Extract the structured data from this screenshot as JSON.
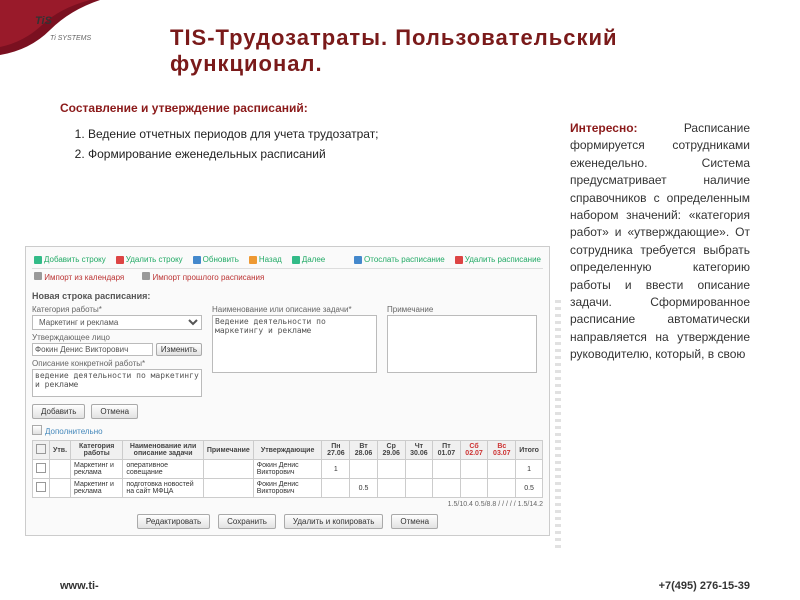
{
  "logo": {
    "main": "TiS",
    "sub": "Ti SYSTEMS"
  },
  "title": "TIS-Трудозатраты. Пользовательский функционал.",
  "left": {
    "heading": "Составление и утверждение расписаний:",
    "items": [
      "Ведение отчетных периодов для учета трудозатрат;",
      "Формирование еженедельных расписаний"
    ]
  },
  "side": {
    "label": "Интересно:",
    "body": "Расписание формируется сотрудниками еженедельно. Система предусматривает наличие справочников с определенным набором значений: «категория работ» и «утверждающие». От сотрудника требуется выбрать определенную категорию работы и ввести описание задачи. Сформированное расписание автоматически направляется на утверждение руководителю, который, в свою"
  },
  "toolbar": {
    "add": "Добавить строку",
    "del": "Удалить строку",
    "upd": "Обновить",
    "back": "Назад",
    "next": "Далее",
    "send": "Отослать расписание",
    "remove": "Удалить расписание",
    "importCal": "Импорт из календаря",
    "importPrev": "Импорт прошлого расписания"
  },
  "form": {
    "section": "Новая строка расписания:",
    "catLabel": "Категория работы*",
    "catValue": "Маркетинг и реклама",
    "apprLabel": "Утверждающее лицо",
    "apprValue": "Фокин Денис Викторович",
    "apprBtn": "Изменить",
    "descLabel": "Наименование или описание задачи*",
    "descValue": "Ведение деятельности по маркетингу и рекламе",
    "objLabel": "Описание конкретной работы*",
    "objValue": "ведение деятельности по маркетингу и рекламе",
    "noteLabel": "Примечание",
    "noteValue": "",
    "addBtn": "Добавить",
    "cancelBtn": "Отмена",
    "additional": "Дополнительно"
  },
  "table": {
    "headers": {
      "approve": "Утв.",
      "cat": "Категория работы",
      "desc": "Наименование или описание задачи",
      "note": "Примечание",
      "appr": "Утверждающие",
      "d1": "Пн 27.06",
      "d2": "Вт 28.06",
      "d3": "Ср 29.06",
      "d4": "Чт 30.06",
      "d5": "Пт 01.07",
      "d6": "Сб 02.07",
      "d7": "Вс 03.07",
      "total": "Итого"
    },
    "rows": [
      {
        "cat": "Маркетинг и реклама",
        "desc": "оперативное совещание",
        "appr": "Фокин Денис Викторович",
        "v": [
          "1",
          "",
          "",
          "",
          "",
          "",
          ""
        ],
        "total": "1"
      },
      {
        "cat": "Маркетинг и реклама",
        "desc": "подготовка новостей на сайт МФЦА",
        "appr": "Фокин Денис Викторович",
        "v": [
          "",
          "0.5",
          "",
          "",
          "",
          "",
          ""
        ],
        "total": "0.5"
      }
    ],
    "pager": "1.5/10.4    0.5/8.8    /    /    /    /    /    1.5/14.2",
    "bottom": {
      "edit": "Редактировать",
      "save": "Сохранить",
      "copy": "Удалить и копировать",
      "cancel": "Отмена"
    }
  },
  "footer": {
    "site": "www.ti-",
    "phone": "+7(495) 276-15-39"
  }
}
